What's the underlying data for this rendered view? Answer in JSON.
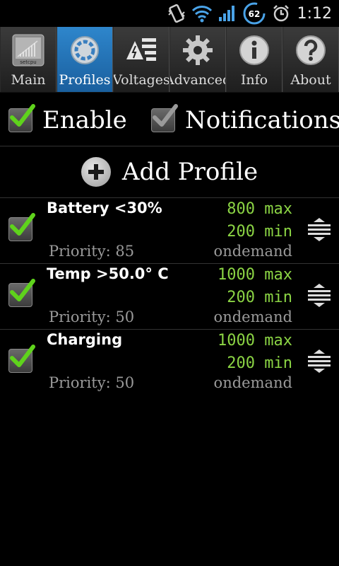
{
  "status_bar": {
    "time": "1:12",
    "battery_level": "62",
    "icons": [
      "vibrate-icon",
      "wifi-icon",
      "signal-icon",
      "battery-icon",
      "alarm-icon"
    ]
  },
  "tabs": [
    {
      "label": "Main",
      "icon": "setcpu-logo-icon",
      "active": false
    },
    {
      "label": "Profiles",
      "icon": "gear-circle-icon",
      "active": true
    },
    {
      "label": "Voltages",
      "icon": "voltage-list-icon",
      "active": false
    },
    {
      "label": "Advanced",
      "icon": "gear-icon",
      "active": false
    },
    {
      "label": "Info",
      "icon": "info-icon",
      "active": false
    },
    {
      "label": "About",
      "icon": "help-icon",
      "active": false
    }
  ],
  "options": {
    "enable_label": "Enable",
    "enable_checked": true,
    "notifications_label": "Notifications",
    "notifications_checked": true
  },
  "add_profile": {
    "label": "Add Profile"
  },
  "profiles": [
    {
      "name": "Battery <30%",
      "max": "800 max",
      "min": "200 min",
      "priority": "Priority: 85",
      "governor": "ondemand",
      "checked": true
    },
    {
      "name": "Temp >50.0° C",
      "max": "1000 max",
      "min": "200 min",
      "priority": "Priority: 50",
      "governor": "ondemand",
      "checked": true
    },
    {
      "name": "Charging",
      "max": "1000 max",
      "min": "200 min",
      "priority": "Priority: 50",
      "governor": "ondemand",
      "checked": true
    }
  ],
  "colors": {
    "accent_green": "#8bd444",
    "tab_active": "#2e86cc",
    "muted_text": "#9a9a9a"
  },
  "setcpu_logo_text": "setcpu"
}
